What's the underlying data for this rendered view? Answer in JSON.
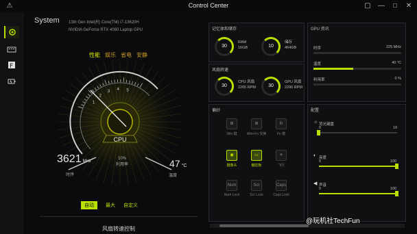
{
  "window": {
    "title": "Control Center"
  },
  "system": {
    "label": "System",
    "cpu_model": "13th Gen Intel(R) Core(TM) i7-13620H",
    "gpu_model": "NVIDIA GeForce RTX 4060 Laptop GPU"
  },
  "modes": [
    "性能",
    "娱乐",
    "省电",
    "安静"
  ],
  "active_mode": "性能",
  "gauge": {
    "center_label": "CPU",
    "ticks": [
      "1",
      "2",
      "3",
      "4",
      "5"
    ],
    "left_value": "3621",
    "left_unit": "MHz",
    "left_label": "时序",
    "usage_value": "10%",
    "usage_label": "利用率",
    "right_value": "47",
    "right_unit": "°C",
    "right_label": "温度"
  },
  "fan_modes": [
    "自动",
    "最大",
    "自定义"
  ],
  "fan_active": "自动",
  "fan_footer_label": "风扇转速控制",
  "memory_panel": {
    "title": "记忆体和储存",
    "ram": {
      "value": "30",
      "name": "RAM",
      "size": "16GB"
    },
    "disk": {
      "value": "10",
      "name": "储存",
      "size": "464GB"
    }
  },
  "fan_panel": {
    "title": "风扇转速",
    "cpu": {
      "value": "30",
      "name": "CPU 风扇",
      "rpm": "2265 RPM"
    },
    "gpu": {
      "value": "30",
      "name": "GPU 风扇",
      "rpm": "2296 RPM"
    }
  },
  "gpu_panel": {
    "title": "GPU 资讯",
    "rows": [
      {
        "label": "时序",
        "value": "225 MHz",
        "fill": 0.0
      },
      {
        "label": "温度",
        "value": "40 °C",
        "fill": 0.45
      },
      {
        "label": "利用率",
        "value": "0 %",
        "fill": 0.0
      }
    ]
  },
  "pref_panel": {
    "title": "偏好",
    "items": [
      {
        "label": "Win 键",
        "glyph": "⊞",
        "on": false
      },
      {
        "label": "Win+Fn 交换",
        "glyph": "⊞",
        "on": false
      },
      {
        "label": "Fn 键",
        "glyph": "fn",
        "on": false
      },
      {
        "label": "摄像头",
        "glyph": "◉",
        "on": true
      },
      {
        "label": "触控板",
        "glyph": "▭",
        "on": true
      },
      {
        "label": "飞行",
        "glyph": "✈",
        "on": false
      },
      {
        "label": "Num Lock",
        "glyph": "Num",
        "on": false
      },
      {
        "label": "Scr Lock",
        "glyph": "Scr",
        "on": false
      },
      {
        "label": "Caps Lock",
        "glyph": "Caps",
        "on": false
      }
    ]
  },
  "config_panel": {
    "title": "配置",
    "sliders": [
      {
        "label": "背光键盘",
        "min": "0",
        "max": "10",
        "fill": 0.0
      },
      {
        "label": "亮度",
        "min": "0",
        "max": "100",
        "fill": 1.0
      },
      {
        "label": "声音",
        "min": "0",
        "max": "100",
        "fill": 1.0
      }
    ]
  },
  "watermark": "@玩机社TechFun",
  "colors": {
    "accent": "#b8e000",
    "gold": "#c99a20",
    "background": "#0b0b0d"
  }
}
